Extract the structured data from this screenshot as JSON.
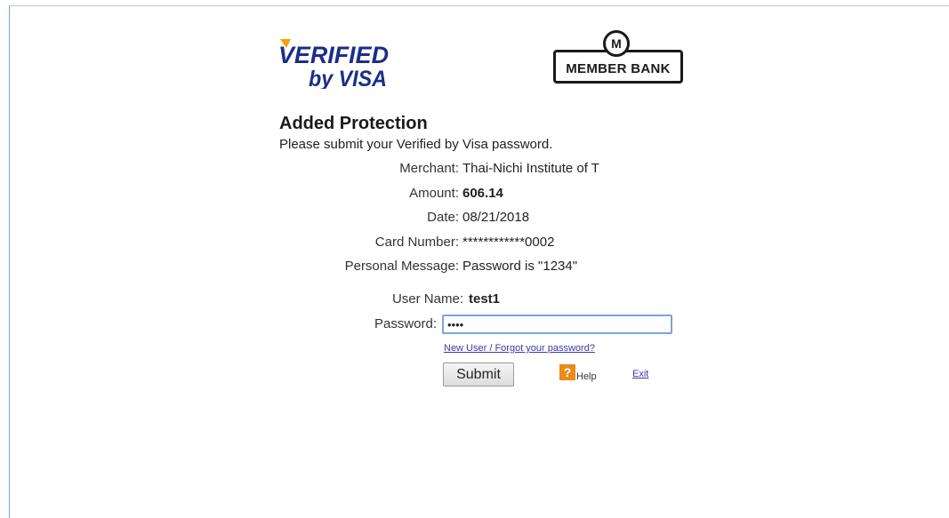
{
  "logos": {
    "visa_line1": "VERIFIED",
    "visa_line2": "by VISA",
    "bank_badge": "M",
    "bank_name": "MEMBER BANK"
  },
  "heading": "Added Protection",
  "subheading": "Please submit your Verified by Visa password.",
  "details": [
    {
      "label": "Merchant:",
      "value": "Thai-Nichi Institute of T"
    },
    {
      "label": "Amount:",
      "value": "606.14"
    },
    {
      "label": "Date:",
      "value": "08/21/2018"
    },
    {
      "label": "Card Number:",
      "value": "************0002"
    },
    {
      "label": "Personal Message:",
      "value": "Password is \"1234\""
    }
  ],
  "login": {
    "username_label": "User Name:",
    "username_value": "test1",
    "password_label": "Password:",
    "password_value": "1234"
  },
  "links": {
    "forgot": "New User / Forgot your password?",
    "help": "Help",
    "exit": "Exit"
  },
  "buttons": {
    "submit": "Submit"
  },
  "icons": {
    "help": "question-mark-icon"
  },
  "colors": {
    "visa_blue": "#1a2f8a",
    "visa_gold": "#f0a500",
    "help_orange": "#e98a1b",
    "link_blue": "#3a3aa8"
  }
}
